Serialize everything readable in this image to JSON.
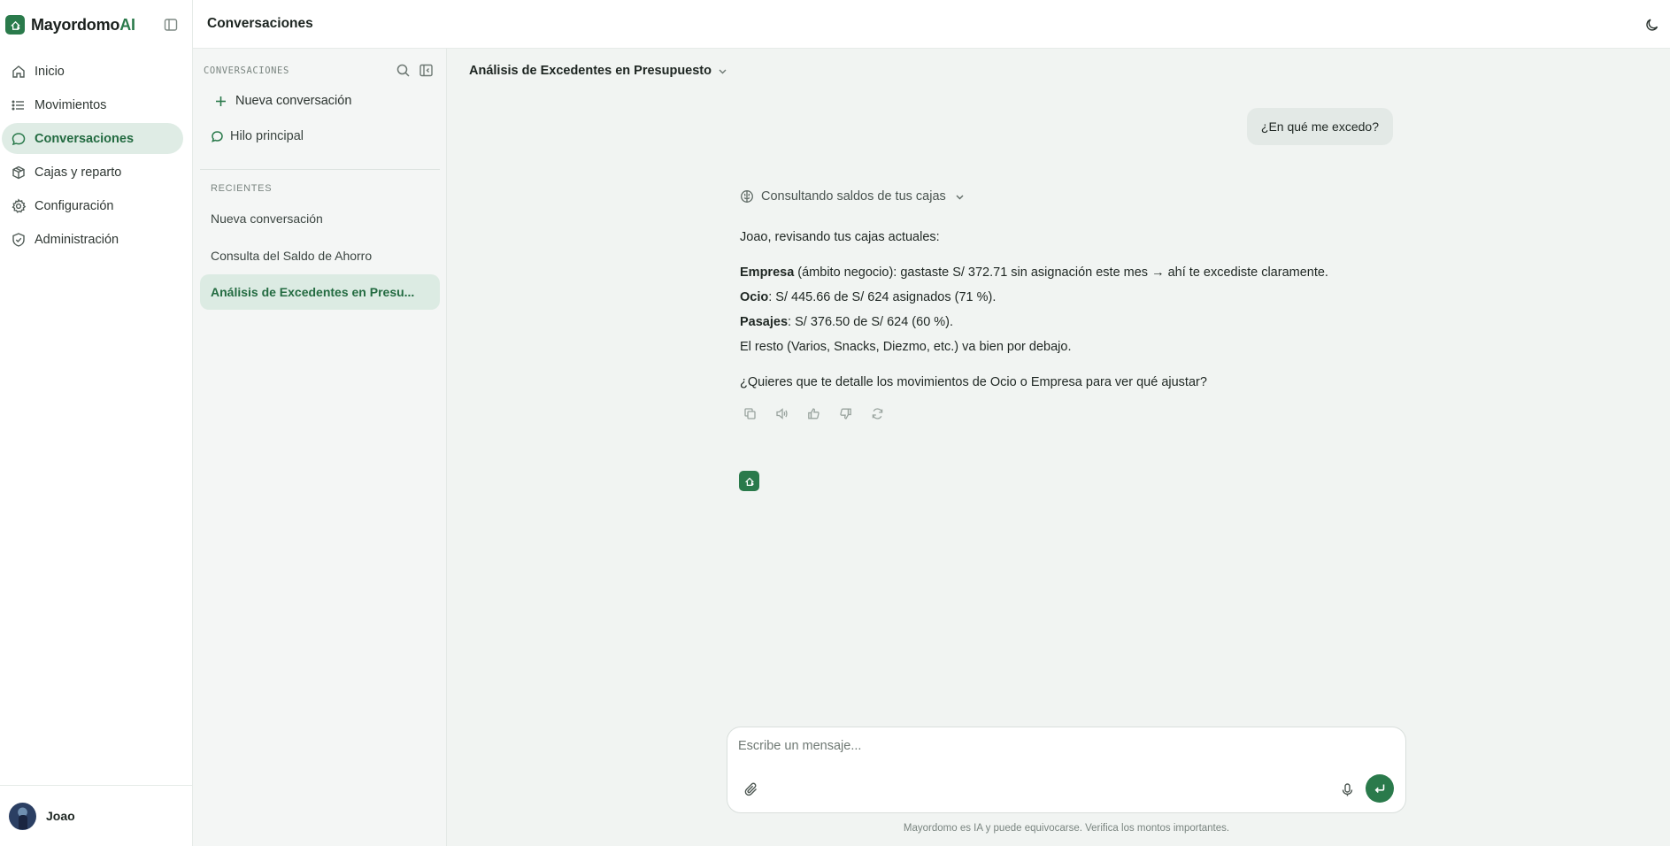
{
  "brand": {
    "name_main": "Mayordomo",
    "name_accent": "AI",
    "accent_color": "#2a7a4b"
  },
  "sidebar": {
    "items": [
      {
        "label": "Inicio",
        "icon": "home-icon",
        "active": false
      },
      {
        "label": "Movimientos",
        "icon": "list-icon",
        "active": false
      },
      {
        "label": "Conversaciones",
        "icon": "chat-bubble-icon",
        "active": true
      },
      {
        "label": "Cajas y reparto",
        "icon": "box-icon",
        "active": false
      },
      {
        "label": "Configuración",
        "icon": "gear-icon",
        "active": false
      },
      {
        "label": "Administración",
        "icon": "shield-check-icon",
        "active": false
      }
    ],
    "user": {
      "name": "Joao"
    }
  },
  "header": {
    "title": "Conversaciones"
  },
  "conversations": {
    "heading": "CONVERSACIONES",
    "new_label": "Nueva conversación",
    "main_thread_label": "Hilo principal",
    "recent_heading": "RECIENTES",
    "recent": [
      {
        "label": "Nueva conversación",
        "active": false
      },
      {
        "label": "Consulta del Saldo de Ahorro",
        "active": false
      },
      {
        "label": "Análisis de Excedentes en Presu...",
        "active": true
      }
    ]
  },
  "chat": {
    "title": "Análisis de Excedentes en Presupuesto",
    "user_message": "¿En qué me excedo?",
    "tool_status": "Consultando saldos de tus cajas",
    "answer": {
      "intro": "Joao, revisando tus cajas actuales:",
      "empresa_label": "Empresa",
      "empresa_text": " (ámbito negocio): gastaste S/ 372.71 sin asignación este mes → ahí te excediste claramente.",
      "ocio_label": "Ocio",
      "ocio_text": ": S/ 445.66 de S/ 624 asignados (71 %).",
      "pasajes_label": "Pasajes",
      "pasajes_text": ": S/ 376.50 de S/ 624 (60 %).",
      "rest": "El resto (Varios, Snacks, Diezmo, etc.) va bien por debajo.",
      "question": "¿Quieres que te detalle los movimientos de Ocio o Empresa para ver qué ajustar?"
    },
    "actions": [
      "copy-icon",
      "speaker-icon",
      "thumbs-up-icon",
      "thumbs-down-icon",
      "regenerate-icon"
    ]
  },
  "composer": {
    "placeholder": "Escribe un mensaje...",
    "value": "",
    "disclaimer": "Mayordomo es IA y puede equivocarse. Verifica los montos importantes."
  }
}
